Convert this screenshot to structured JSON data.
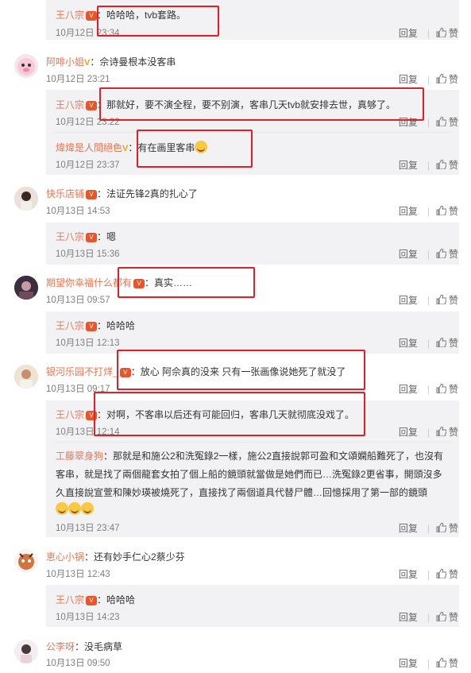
{
  "ui": {
    "reply_label": "回复",
    "like_label": "赞",
    "colon": "："
  },
  "comments": [
    {
      "id": "c0",
      "type": "reply",
      "name": "王八宗",
      "text": "哈哈哈，tvb套路。",
      "time": "10月12日 23:34"
    },
    {
      "id": "c1",
      "type": "top",
      "name": "阿啡小姐",
      "verified": "V",
      "text": "佘诗曼根本没客串",
      "time": "10月12日 23:21"
    },
    {
      "id": "c2",
      "type": "reply",
      "name": "王八宗",
      "text": "那就好，要不演全程，要不别演，客串几天tvb就安排去世，真够了。",
      "time": "10月12日 23:22"
    },
    {
      "id": "c3",
      "type": "reply",
      "name": "煒煒是人間絕色",
      "verified": "V",
      "text": "有在画里客串",
      "time": "10月12日 23:37"
    },
    {
      "id": "c4",
      "type": "top",
      "name": "快乐店铺",
      "text": "法证先锋2真的扎心了",
      "time": "10月13日 14:53"
    },
    {
      "id": "c5",
      "type": "reply",
      "name": "王八宗",
      "text": "嗯",
      "time": "10月13日 15:36"
    },
    {
      "id": "c6",
      "type": "top",
      "name": "期望你幸福什么都有",
      "text": "真实……",
      "time": "10月13日 09:57"
    },
    {
      "id": "c7",
      "type": "reply",
      "name": "王八宗",
      "text": "哈哈哈",
      "time": "10月13日 12:13"
    },
    {
      "id": "c8",
      "type": "top",
      "name": "银河乐园不打烊_",
      "text": "放心 阿佘真的没来 只有一张画像说她死了就没了",
      "time": "10月13日 09:17"
    },
    {
      "id": "c9",
      "type": "reply",
      "name": "王八宗",
      "text": "对啊，不客串以后还有可能回归，客串几天就彻底没戏了。",
      "time": "10月13日 12:14"
    },
    {
      "id": "c10",
      "type": "reply",
      "name": "工藤翠身狗",
      "text_lines": [
        "那就是和施公2和洗冤錄2一樣，施公2直接說郭可盈和文頌嫻船難死了，也沒有",
        "客串，就是找了兩個龍套女拍了個上船的鏡頭就當做是她們而已…洗冤錄2更省事，開頭沒多",
        "久直接說宣萱和陳妙瑛被燒死了，直接找了兩個道具代替尸體…回憶採用了第一部的鏡頭"
      ],
      "time": "10月13日 23:47"
    },
    {
      "id": "c11",
      "type": "top",
      "name": "恵心小锅",
      "text": "还有妙手仁心2蔡少芬",
      "time": "10月13日 12:43"
    },
    {
      "id": "c12",
      "type": "reply",
      "name": "王八宗",
      "text": "哈哈哈",
      "time": "10月13日 14:23"
    },
    {
      "id": "c13",
      "type": "top",
      "name": "公李呀",
      "text": "没毛病草",
      "time": "10月13日 09:50"
    }
  ]
}
